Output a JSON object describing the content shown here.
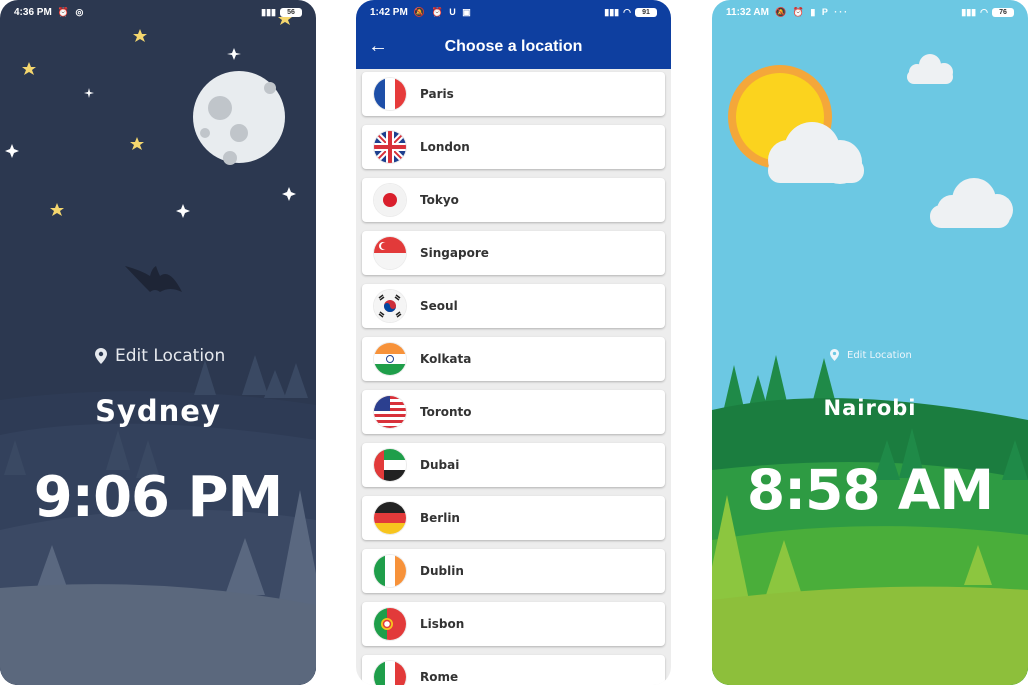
{
  "night_screen": {
    "status_time": "4:36 PM",
    "status_icons": "⏰ ◎",
    "battery": "56",
    "edit_location": "Edit Location",
    "city": "Sydney",
    "time": "9:06 PM"
  },
  "list_screen": {
    "status_time": "1:42 PM",
    "status_icons": "🔕 ⏰ U ▣",
    "battery": "91",
    "title": "Choose a location",
    "back_icon": "arrow-back-icon",
    "locations": [
      {
        "name": "Paris",
        "flag": "france"
      },
      {
        "name": "London",
        "flag": "uk"
      },
      {
        "name": "Tokyo",
        "flag": "japan"
      },
      {
        "name": "Singapore",
        "flag": "singapore"
      },
      {
        "name": "Seoul",
        "flag": "south-korea"
      },
      {
        "name": "Kolkata",
        "flag": "india"
      },
      {
        "name": "Toronto",
        "flag": "usa"
      },
      {
        "name": "Dubai",
        "flag": "uae"
      },
      {
        "name": "Berlin",
        "flag": "germany"
      },
      {
        "name": "Dublin",
        "flag": "ireland"
      },
      {
        "name": "Lisbon",
        "flag": "portugal"
      },
      {
        "name": "Rome",
        "flag": "italy"
      }
    ]
  },
  "day_screen": {
    "status_time": "11:32 AM",
    "status_icons": "🔕 ⏰ ▮ P ···",
    "battery": "76",
    "edit_location": "Edit Location",
    "city": "Nairobi",
    "time": "8:58 AM"
  },
  "colors": {
    "night_bg": "#2c3850",
    "day_sky": "#6cc8e3",
    "appbar_blue": "#0e3fa0",
    "list_bg": "#ededed"
  }
}
